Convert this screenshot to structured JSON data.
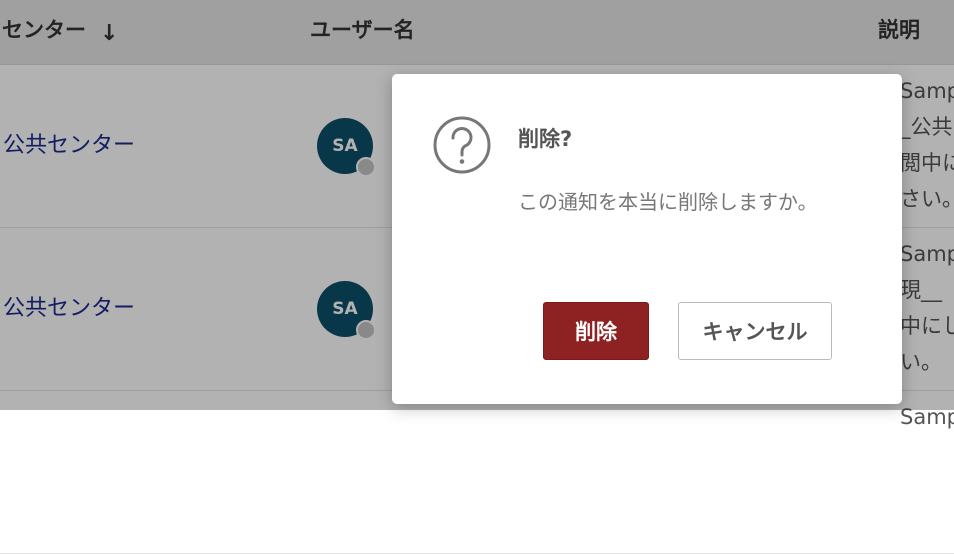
{
  "table": {
    "headers": {
      "center": "センター",
      "sort_icon": "arrow-down",
      "user_name": "ユーザー名",
      "description": "説明"
    },
    "rows": [
      {
        "center": "公共センター",
        "avatar": "SA",
        "desc_lines": [
          "Samp",
          "_公共",
          "閲中に",
          "さい。"
        ]
      },
      {
        "center": "公共センター",
        "avatar": "SA",
        "desc_lines": [
          "Samp",
          "現__",
          "中にし",
          "い。"
        ]
      },
      {
        "center": "",
        "avatar": "",
        "desc_lines": [
          "Samp"
        ]
      }
    ]
  },
  "dialog": {
    "icon": "question-circle",
    "title": "削除?",
    "message": "この通知を本当に削除しますか。",
    "delete_label": "削除",
    "cancel_label": "キャンセル"
  },
  "colors": {
    "link": "#1a2a8f",
    "avatar_bg": "#0e4f6b",
    "delete_button": "#8e2121",
    "overlay": "rgba(0,0,0,0.30)"
  }
}
